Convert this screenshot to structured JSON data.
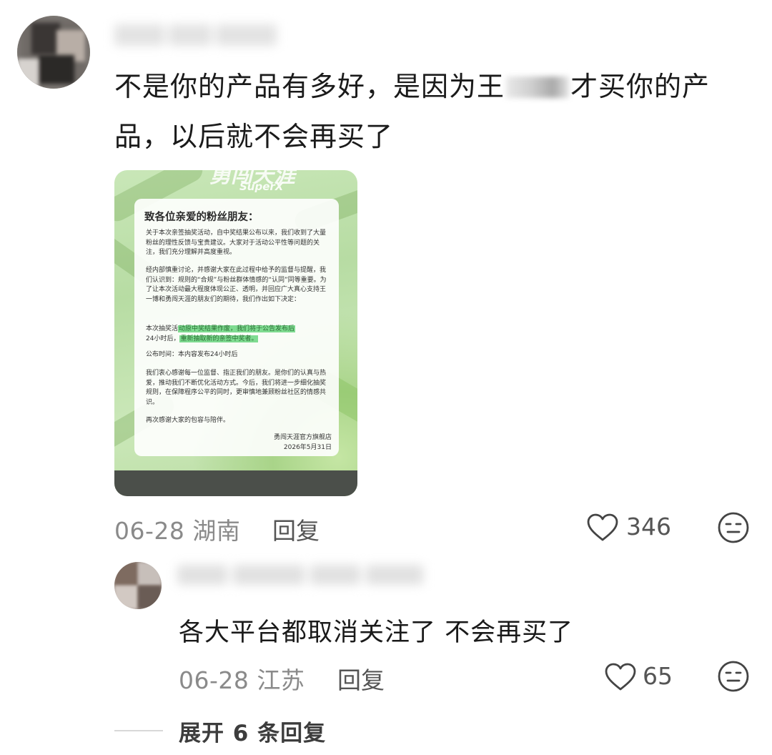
{
  "comment": {
    "text_before": "不是你的产品有多好，是因为王",
    "text_after": "才买你的产品，以后就不会再买了",
    "date": "06-28",
    "location": "湖南",
    "reply_label": "回复",
    "likes": "346"
  },
  "notice_image": {
    "brand": "勇闯天涯",
    "brand_sub": "SuperX",
    "title": "致各位亲爱的粉丝朋友：",
    "para1": "关于本次亲签抽奖活动，自中奖结果公布以来，我们收到了大量粉丝的理性反馈与宝贵建议。大家对于活动公平性等问题的关注，我们充分理解并高度重视。",
    "para2": "经内部慎重讨论，并感谢大家在此过程中给予的监督与提醒，我们认识到：规则的“合规”与粉丝群体情感的“认同”同等重要。为了让本次活动最大程度体现公正、透明，并回应广大真心支持王一博和勇闯天涯的朋友们的期待，我们作出如下决定：",
    "para3_a": "本次抽奖活",
    "para3_b": "动原中奖结果作废，我们将于公告发布后",
    "para3_c": "24小时后，",
    "para3_d": "重新抽取新的亲签中奖者。",
    "para4": "公布时间：本内容发布24小时后",
    "para5": "我们衷心感谢每一位监督、指正我们的朋友。是你们的认真与热爱，推动我们不断优化活动方式。今后，我们将进一步细化抽奖规则，在保障程序公平的同时，更审慎地兼顾粉丝社区的情感共识。",
    "para6": "再次感谢大家的包容与陪伴。",
    "store": "勇闯天涯官方旗舰店",
    "date": "2026年5月31日"
  },
  "reply": {
    "text": "各大平台都取消关注了 不会再买了",
    "date": "06-28",
    "location": "江苏",
    "reply_label": "回复",
    "likes": "65"
  },
  "expand": {
    "label": "展开 6 条回复"
  }
}
